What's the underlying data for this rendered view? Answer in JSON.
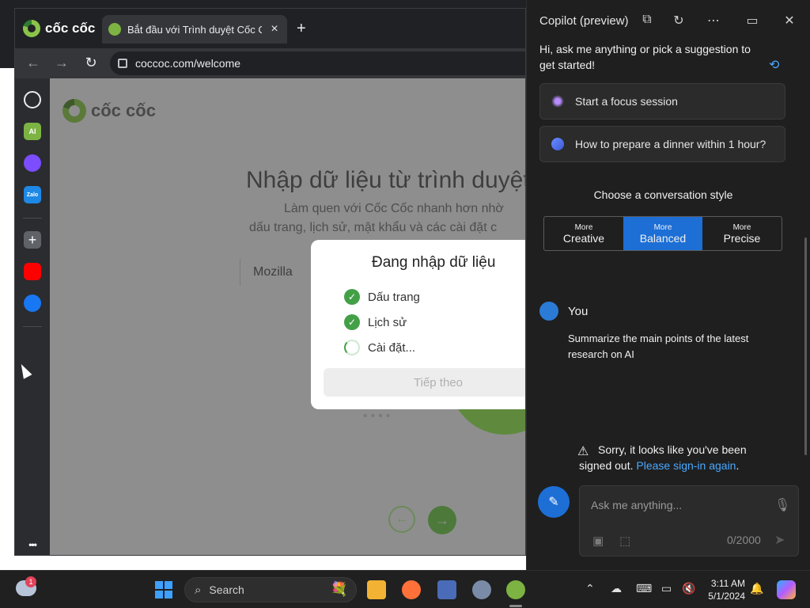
{
  "browser": {
    "brand": "cốc cốc",
    "tab": {
      "title": "Bắt đầu với Trình duyệt Cốc Cốc",
      "close": "×"
    },
    "new_tab": "+",
    "toolbar": {
      "back": "←",
      "forward": "→",
      "reload": "↻",
      "url": "coccoc.com/welcome"
    },
    "sidebar": {
      "more": "•••",
      "ai_label": "AI",
      "zalo_label": "Zalo",
      "add": "+"
    }
  },
  "welcome": {
    "logo": "cốc cốc",
    "heading": "Nhập dữ liệu từ trình duyệt",
    "line1": "Làm quen với Cốc Cốc nhanh hơn nhờ",
    "line2": "dấu trang, lịch sử, mật khẩu và các cài đặt c",
    "browser_select": "Mozilla",
    "dots": "••••",
    "prev": "←",
    "next": "→"
  },
  "import_dialog": {
    "title": "Đang nhập dữ liệu",
    "items": [
      {
        "label": "Dấu trang",
        "state": "done"
      },
      {
        "label": "Lịch sử",
        "state": "done"
      },
      {
        "label": "Cài đặt...",
        "state": "loading"
      }
    ],
    "next_button": "Tiếp theo"
  },
  "copilot": {
    "title": "Copilot (preview)",
    "greeting": "Hi, ask me anything or pick a suggestion to get started!",
    "suggestions": [
      {
        "label": "Start a focus session",
        "icon": "sparkle-icon"
      },
      {
        "label": "How to prepare a dinner within 1 hour?",
        "icon": "chat-icon"
      }
    ],
    "style_label": "Choose a conversation style",
    "styles": [
      {
        "small": "More",
        "big": "Creative",
        "active": false
      },
      {
        "small": "More",
        "big": "Balanced",
        "active": true
      },
      {
        "small": "More",
        "big": "Precise",
        "active": false
      }
    ],
    "user_name": "You",
    "user_message": "Summarize the main points of the latest research on AI",
    "signed_out_text": "Sorry, it looks like you've been signed out.",
    "signed_out_link": "Please sign-in again",
    "signed_out_end": ".",
    "input_placeholder": "Ask me anything...",
    "counter": "0/2000"
  },
  "taskbar": {
    "weather_badge": "1",
    "search_label": "Search",
    "clock_time": "3:11 AM",
    "clock_date": "5/1/2024"
  },
  "colors": {
    "accent_blue": "#1d6fd6",
    "link_blue": "#4aa8ff",
    "check_green": "#43a047",
    "coccoc_green": "#7cb342"
  }
}
